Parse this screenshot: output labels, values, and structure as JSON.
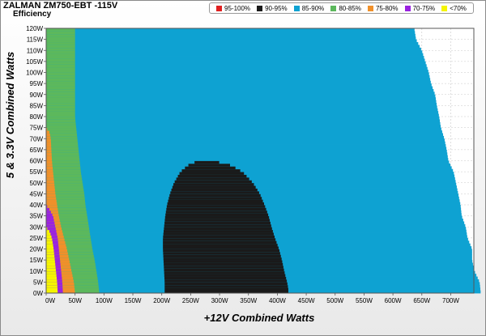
{
  "chart_data": {
    "type": "heatmap",
    "title": "ZALMAN ZM750-EBT -115V",
    "subtitle": "Efficiency",
    "xlabel": "+12V Combined Watts",
    "ylabel": "5 & 3.3V Combined Watts",
    "xlim": [
      0,
      740
    ],
    "ylim": [
      0,
      120
    ],
    "grid": true,
    "legend_position": "top-right",
    "x_ticks": [
      "0W",
      "50W",
      "100W",
      "150W",
      "200W",
      "250W",
      "300W",
      "350W",
      "400W",
      "450W",
      "500W",
      "550W",
      "600W",
      "650W",
      "700W"
    ],
    "x_tick_values": [
      0,
      50,
      100,
      150,
      200,
      250,
      300,
      350,
      400,
      450,
      500,
      550,
      600,
      650,
      700
    ],
    "y_ticks": [
      "0W",
      "5W",
      "10W",
      "15W",
      "20W",
      "25W",
      "30W",
      "35W",
      "40W",
      "45W",
      "50W",
      "55W",
      "60W",
      "65W",
      "70W",
      "75W",
      "80W",
      "85W",
      "90W",
      "95W",
      "100W",
      "105W",
      "110W",
      "115W",
      "120W"
    ],
    "y_tick_values": [
      0,
      5,
      10,
      15,
      20,
      25,
      30,
      35,
      40,
      45,
      50,
      55,
      60,
      65,
      70,
      75,
      80,
      85,
      90,
      95,
      100,
      105,
      110,
      115,
      120
    ],
    "legend": [
      {
        "label": "95-100%",
        "color": "#e02020"
      },
      {
        "label": "90-95%",
        "color": "#1a1a1a"
      },
      {
        "label": "85-90%",
        "color": "#0ea2d2"
      },
      {
        "label": "80-85%",
        "color": "#5cb85c"
      },
      {
        "label": "75-80%",
        "color": "#f0902a"
      },
      {
        "label": "70-75%",
        "color": "#9a22e0"
      },
      {
        "label": "<70%",
        "color": "#f5f500"
      }
    ],
    "load_limit_x": [
      [
        0,
        752
      ],
      [
        5,
        750
      ],
      [
        10,
        741
      ],
      [
        15,
        737
      ],
      [
        20,
        737
      ],
      [
        25,
        729
      ],
      [
        30,
        726
      ],
      [
        35,
        719
      ],
      [
        40,
        717
      ],
      [
        45,
        713
      ],
      [
        50,
        709
      ],
      [
        55,
        705
      ],
      [
        60,
        696
      ],
      [
        65,
        693
      ],
      [
        70,
        689
      ],
      [
        75,
        683
      ],
      [
        80,
        680
      ],
      [
        85,
        676
      ],
      [
        90,
        673
      ],
      [
        95,
        666
      ],
      [
        100,
        662
      ],
      [
        105,
        656
      ],
      [
        110,
        650
      ],
      [
        115,
        640
      ],
      [
        120,
        637
      ]
    ],
    "region_90_95": [
      [
        0,
        205,
        419
      ],
      [
        2,
        205,
        419
      ],
      [
        5,
        205,
        417
      ],
      [
        10,
        204,
        412
      ],
      [
        15,
        203,
        408
      ],
      [
        20,
        202,
        403
      ],
      [
        25,
        202,
        396
      ],
      [
        30,
        204,
        390
      ],
      [
        35,
        206,
        385
      ],
      [
        40,
        209,
        378
      ],
      [
        45,
        214,
        370
      ],
      [
        50,
        221,
        358
      ],
      [
        55,
        232,
        340
      ],
      [
        58,
        245,
        320
      ],
      [
        60,
        262,
        290
      ]
    ],
    "band_80_85": [
      [
        0,
        92
      ],
      [
        5,
        90
      ],
      [
        10,
        87
      ],
      [
        15,
        84
      ],
      [
        20,
        80
      ],
      [
        25,
        77
      ],
      [
        30,
        74
      ],
      [
        35,
        71
      ],
      [
        40,
        68
      ],
      [
        45,
        66
      ],
      [
        50,
        63
      ],
      [
        55,
        60
      ],
      [
        60,
        58
      ],
      [
        65,
        56
      ],
      [
        70,
        54
      ],
      [
        75,
        52
      ],
      [
        80,
        50
      ],
      [
        85,
        50
      ],
      [
        90,
        50
      ],
      [
        95,
        50
      ],
      [
        100,
        50
      ],
      [
        105,
        50
      ],
      [
        110,
        50
      ],
      [
        115,
        50
      ],
      [
        120,
        50
      ]
    ],
    "band_75_80": [
      [
        0,
        50
      ],
      [
        5,
        48
      ],
      [
        10,
        44
      ],
      [
        15,
        40
      ],
      [
        20,
        36
      ],
      [
        25,
        31
      ],
      [
        30,
        26
      ],
      [
        35,
        22
      ],
      [
        40,
        19
      ],
      [
        45,
        16
      ],
      [
        50,
        14
      ],
      [
        55,
        12
      ],
      [
        60,
        10
      ],
      [
        65,
        9
      ],
      [
        70,
        8
      ],
      [
        73,
        6
      ],
      [
        75,
        0
      ],
      [
        120,
        0
      ]
    ],
    "band_70_75": [
      [
        0,
        29
      ],
      [
        5,
        28
      ],
      [
        10,
        26
      ],
      [
        15,
        24
      ],
      [
        20,
        22
      ],
      [
        25,
        20
      ],
      [
        30,
        16
      ],
      [
        35,
        12
      ],
      [
        38,
        6
      ],
      [
        40,
        0
      ],
      [
        120,
        0
      ]
    ],
    "band_lt70": [
      [
        0,
        20
      ],
      [
        5,
        19
      ],
      [
        10,
        17
      ],
      [
        15,
        15
      ],
      [
        20,
        13
      ],
      [
        25,
        10
      ],
      [
        28,
        6
      ],
      [
        30,
        0
      ],
      [
        120,
        0
      ]
    ]
  }
}
